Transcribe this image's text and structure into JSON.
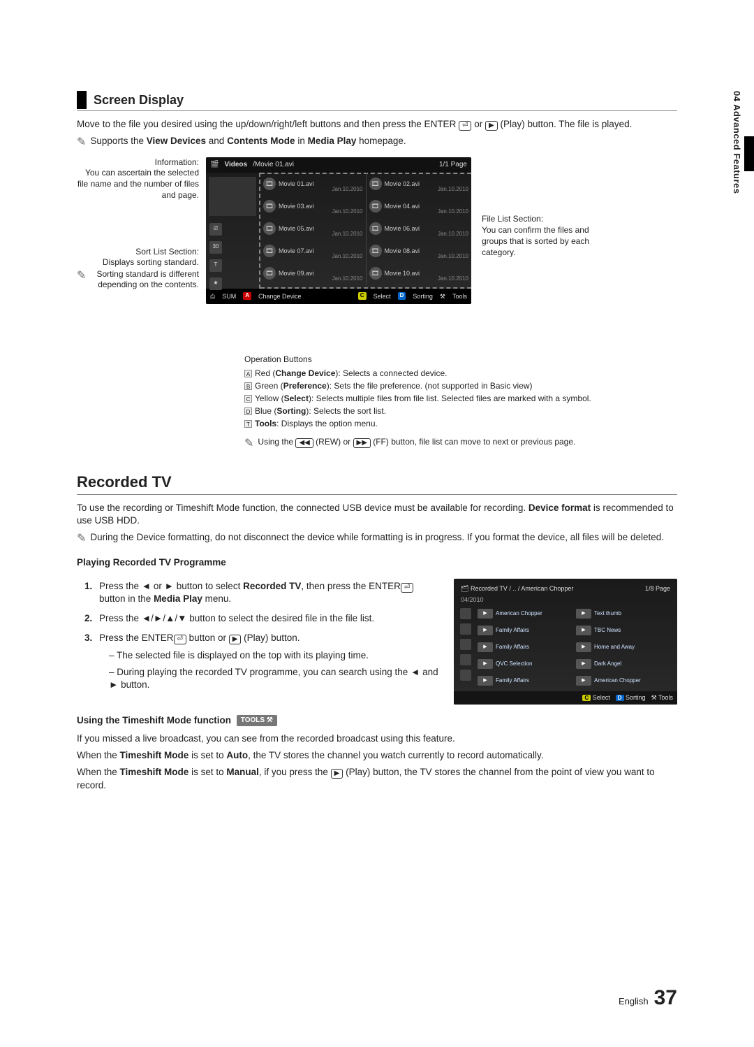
{
  "sideTab": "04  Advanced Features",
  "section1Title": "Screen Display",
  "intro": "Move to the file you desired using the up/down/right/left buttons and then press the ENTER",
  "introAfterEnter": " or ",
  "introAfterPlay": " (Play) button. The file is played.",
  "supportsLine": {
    "pre": "Supports the ",
    "b1": "View Devices",
    "mid": " and ",
    "b2": "Contents Mode",
    "post": " in ",
    "b3": "Media Play",
    "end": " homepage."
  },
  "annLeft1": {
    "title": "Information:",
    "body": "You can ascertain the selected file name and the number of files and page."
  },
  "annLeft2": {
    "title": "Sort List Section:",
    "body": "Displays sorting standard."
  },
  "annLeft3": "Sorting standard is different depending on the contents.",
  "annRight": {
    "title": "File List Section:",
    "body": "You can confirm the files and groups that is sorted by each category."
  },
  "mock": {
    "cat": "Videos",
    "path": "/Movie 01.avi",
    "page": "1/1 Page",
    "rows": [
      [
        "Movie 01.avi",
        "Movie 02.avi"
      ],
      [
        "Movie 03.avi",
        "Movie 04.avi"
      ],
      [
        "Movie 05.avi",
        "Movie 06.avi"
      ],
      [
        "Movie 07.avi",
        "Movie 08.avi"
      ],
      [
        "Movie 09.avi",
        "Movie 10.avi"
      ]
    ],
    "date": "Jan.10.2010",
    "bottom": {
      "sum": "SUM",
      "a": "Change Device",
      "c": "Select",
      "d": "Sorting",
      "t": "Tools"
    }
  },
  "opHeader": "Operation Buttons",
  "ops": [
    {
      "sq": "A",
      "colorWord": "Red",
      "label": "Change Device",
      "desc": ": Selects a connected device."
    },
    {
      "sq": "B",
      "colorWord": "Green",
      "label": "Preference",
      "desc": ": Sets the file preference. (not supported in Basic view)"
    },
    {
      "sq": "C",
      "colorWord": "Yellow",
      "label": "Select",
      "desc": ": Selects multiple files from file list. Selected files are marked with a symbol."
    },
    {
      "sq": "D",
      "colorWord": "Blue",
      "label": "Sorting",
      "desc": ": Selects the sort list."
    },
    {
      "sq": "T",
      "colorWord": "",
      "label": "Tools",
      "desc": ": Displays the option menu."
    }
  ],
  "opNote": {
    "pre": "Using the ",
    "rew": " (REW) or ",
    "ff": " (FF) button, file list can move to next or previous page."
  },
  "section2Title": "Recorded TV",
  "rec_intro": {
    "pre": "To use the recording or Timeshift Mode function, the connected USB device must be available for recording. ",
    "b": "Device format",
    "post": " is recommended to use USB HDD."
  },
  "rec_note": "During the Device formatting, do not disconnect the device while formatting is in progress. If you format the device, all files will be deleted.",
  "playHeader": "Playing Recorded TV Programme",
  "steps": {
    "s1a": "Press the ◄ or ► button to select ",
    "s1b": "Recorded TV",
    "s1c": ", then press the ENTER",
    "s1d": " button in the ",
    "s1e": "Media Play",
    "s1f": " menu.",
    "s2": "Press the ◄/►/▲/▼ button to select the desired file in the file list.",
    "s3a": "Press the ENTER",
    "s3b": " button or ",
    "s3c": " (Play) button.",
    "s3d1": "The selected file is displayed on the top with its playing time.",
    "s3d2": "During playing the recorded TV programme, you can search using the ◄ and ► button."
  },
  "recMock": {
    "path": "Recorded TV / .. / American Chopper",
    "page": "1/8 Page",
    "date": "04/2010",
    "rows": [
      [
        "American Chopper",
        "Text thumb"
      ],
      [
        "Family Affairs",
        "TBC News"
      ],
      [
        "Family Affairs",
        "Home and Away"
      ],
      [
        "QVC Selection",
        "Dark Angel"
      ],
      [
        "Family Affairs",
        "American Chopper"
      ]
    ],
    "bottom": {
      "c": "Select",
      "d": "Sorting",
      "t": "Tools"
    }
  },
  "timeshiftHeader": "Using the Timeshift Mode function",
  "toolsPill": "TOOLS",
  "ts1": "If you missed a live broadcast, you can see from the recorded broadcast using this feature.",
  "ts2": {
    "pre": "When the ",
    "b": "Timeshift Mode",
    "mid": " is set to ",
    "b2": "Auto",
    "post": ", the TV stores the channel you watch currently to record automatically."
  },
  "ts3": {
    "pre": "When the ",
    "b": "Timeshift Mode",
    "mid": " is set to ",
    "b2": "Manual",
    "post1": ", if you press the ",
    "post2": " (Play) button, the TV stores the channel from the point of view you want to record."
  },
  "footer": {
    "lang": "English",
    "num": "37"
  }
}
